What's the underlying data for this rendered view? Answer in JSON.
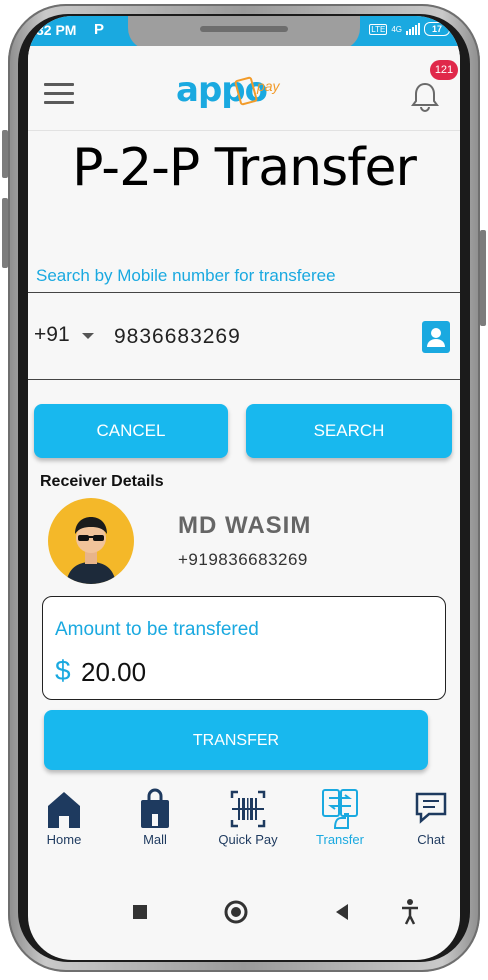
{
  "status_bar": {
    "time": "32 PM",
    "app_letter": "P",
    "network_badge": "4G",
    "lte_badge": "LTE",
    "battery": "17"
  },
  "header": {
    "logo_text": "appo",
    "logo_sub": "pay",
    "notification_count": "121"
  },
  "page": {
    "title": "P-2-P Transfer"
  },
  "search": {
    "label": "Search by Mobile number for transferee",
    "country_code": "+91",
    "mobile_value": "9836683269"
  },
  "buttons": {
    "cancel": "CANCEL",
    "search": "SEARCH",
    "transfer": "TRANSFER"
  },
  "receiver": {
    "heading": "Receiver Details",
    "name": "MD WASIM",
    "phone": "+919836683269"
  },
  "amount": {
    "label": "Amount to be transfered",
    "currency": "$",
    "value": "20.00"
  },
  "tabs": [
    {
      "label": "Home",
      "icon": "home-icon"
    },
    {
      "label": "Mall",
      "icon": "shopping-bag-icon"
    },
    {
      "label": "Quick Pay",
      "icon": "barcode-scan-icon"
    },
    {
      "label": "Transfer",
      "icon": "transfer-icon",
      "active": true
    },
    {
      "label": "Chat",
      "icon": "chat-icon"
    }
  ],
  "colors": {
    "accent": "#1aa9e0",
    "button": "#18b8ee",
    "badge": "#e0284a",
    "avatar_bg": "#f4b829",
    "tab_icon": "#1e3a5f"
  }
}
